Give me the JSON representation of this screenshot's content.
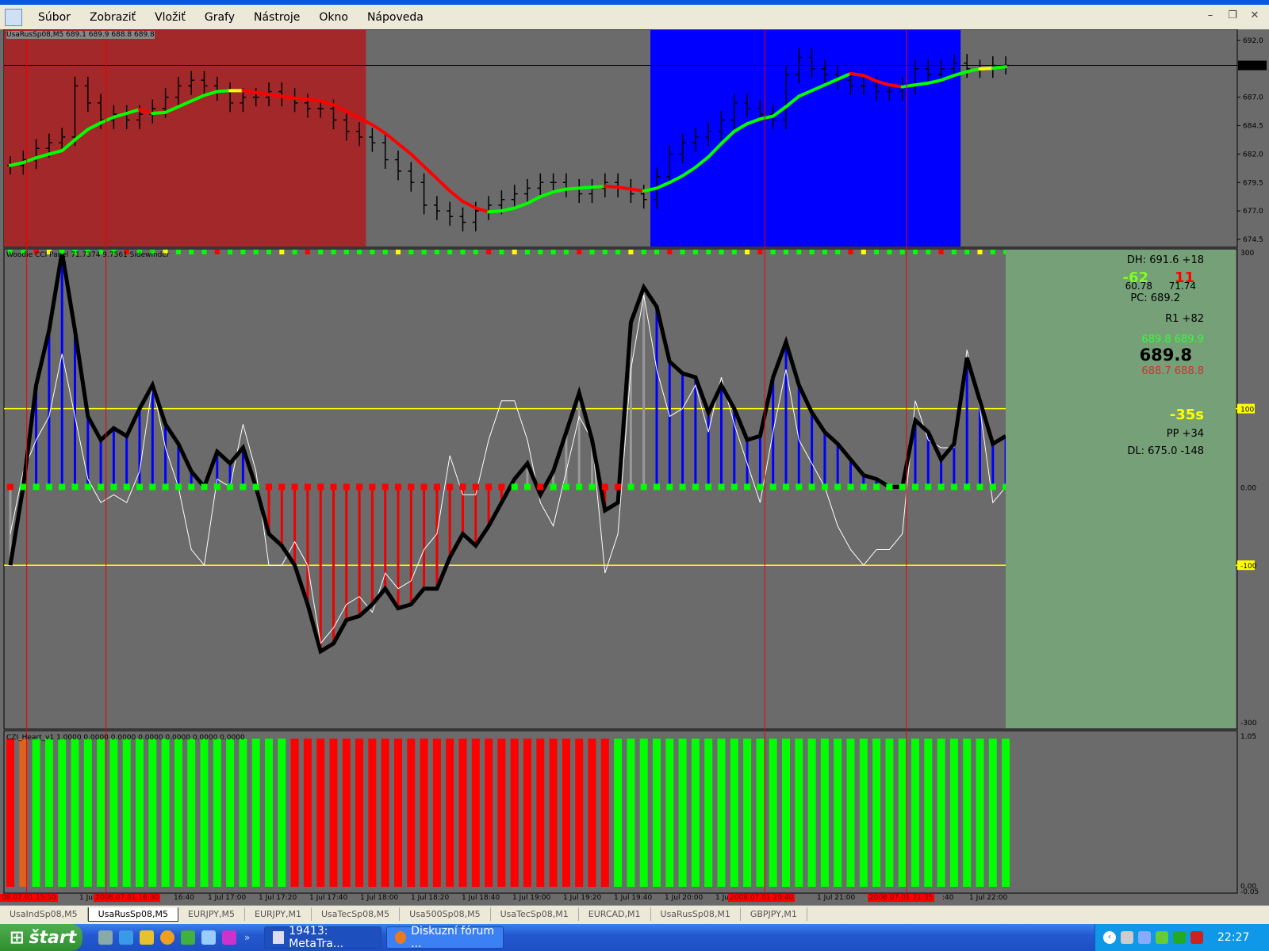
{
  "menu": {
    "items": [
      "Súbor",
      "Zobraziť",
      "Vložiť",
      "Grafy",
      "Nástroje",
      "Okno",
      "Nápoveda"
    ]
  },
  "window_controls": {
    "minimize": "–",
    "restore": "❐",
    "close": "✕"
  },
  "price_pane": {
    "label": "UsaRusSp08,M5  689.1 689.9 688.8 689.8",
    "axis_ticks": [
      "692.0",
      "687.0",
      "684.5",
      "682.0",
      "679.5",
      "677.0",
      "674.5"
    ],
    "current_price": "689.8"
  },
  "cci_pane": {
    "label": "Woodie CCI Panel 71.7374 9.7561  Sidewinder",
    "axis_ticks": {
      "top": "300",
      "upper": "100",
      "zero": "0.00",
      "lower": "-100",
      "bottom": "-300"
    }
  },
  "heart_pane": {
    "label": "CZI_Heart_v1 1.0000 0.0000 0.0000 0.0000 0.0000 0.0000 0.0000",
    "axis_ticks": {
      "top": "1.05",
      "bottom": "0.00",
      "bottom2": "-0.05"
    }
  },
  "info_panel": {
    "dh": "DH: 691.6 +18",
    "green_num": "-62",
    "red_num": "11",
    "val_left": "60.78",
    "val_right": "71.74",
    "pc": "PC: 689.2",
    "r1": "R1 +82",
    "ask_pair": "689.8  689.9",
    "price": "689.8",
    "bid_pair": "688.7  688.8",
    "timer": "-35s",
    "pp": "PP +34",
    "dl": "DL: 675.0 -148"
  },
  "time_axis": {
    "labels": [
      "1 Jul 16:00",
      "16:40",
      "1 Jul 17:00",
      "1 Jul 17:20",
      "1 Jul 17:40",
      "1 Jul 18:00",
      "1 Jul 18:20",
      "1 Jul 18:40",
      "1 Jul 19:00",
      "1 Jul 19:20",
      "1 Jul 19:40",
      "1 Jul 20:00",
      "1 Ju",
      "1 Jul 21:00",
      ":40",
      "1 Jul 22:00"
    ],
    "cursor_labels": [
      "08.07.01 15:50",
      "2008.07.01 16:30",
      "2008.07.01 20:40",
      "2008.07.01 21:35"
    ]
  },
  "tabs": [
    "UsaIndSp08,M5",
    "UsaRusSp08,M5",
    "EURJPY,M5",
    "EURJPY,M1",
    "UsaTecSp08,M5",
    "Usa500Sp08,M5",
    "UsaTecSp08,M1",
    "EURCAD,M1",
    "UsaRusSp08,M1",
    "GBPJPY,M1"
  ],
  "active_tab": "UsaRusSp08,M5",
  "taskbar": {
    "start": "štart",
    "tasks": [
      "19413: MetaTra...",
      "Diskuzní fórum ..."
    ],
    "clock": "22:27"
  },
  "colors": {
    "red_zone": "#a3282a",
    "blue_zone": "#0000ff",
    "bg": "#6b6b6b",
    "up": "#00ff00",
    "down": "#ff0000",
    "flat": "#ffff00",
    "panel": "#76a078"
  },
  "chart_data": [
    {
      "type": "line",
      "title": "UsaRusSp08,M5",
      "ylim": [
        674.5,
        692.0
      ],
      "close": [
        681,
        681.5,
        682.5,
        683,
        683.5,
        688,
        686.5,
        685,
        685.5,
        685,
        685.5,
        686,
        687,
        688,
        688.5,
        688,
        687.5,
        686.5,
        687,
        687,
        687.5,
        687,
        686.5,
        686,
        686,
        685,
        684,
        683.5,
        683,
        681.5,
        680.5,
        679.5,
        677.5,
        677,
        676.5,
        676,
        677,
        677.5,
        678,
        678.5,
        679,
        679.5,
        679.5,
        679,
        678.5,
        679,
        679.5,
        679,
        678.5,
        678,
        680,
        682,
        683,
        683.5,
        684,
        685,
        686.5,
        686,
        685.5,
        685,
        689,
        690.5,
        689.5,
        689,
        688.5,
        688,
        688,
        687.5,
        687.5,
        688,
        689.5,
        689,
        689.5,
        690,
        689.5,
        689.5,
        689.8,
        689.8
      ],
      "zones": [
        {
          "from": 0,
          "to": 27,
          "color": "#a3282a"
        },
        {
          "from": 50,
          "to": 73,
          "color": "#0000ff"
        }
      ]
    },
    {
      "type": "line",
      "title": "Woodie CCI",
      "ylim": [
        -300,
        300
      ],
      "cci": [
        -100,
        0,
        130,
        200,
        300,
        200,
        90,
        60,
        75,
        65,
        100,
        130,
        80,
        55,
        20,
        0,
        45,
        30,
        50,
        0,
        -60,
        -75,
        -100,
        -150,
        -210,
        -200,
        -170,
        -165,
        -150,
        -130,
        -155,
        -150,
        -130,
        -130,
        -90,
        -60,
        -75,
        -50,
        -20,
        10,
        30,
        -10,
        20,
        70,
        120,
        60,
        -30,
        -20,
        210,
        255,
        230,
        160,
        145,
        140,
        95,
        130,
        100,
        60,
        65,
        140,
        185,
        130,
        95,
        70,
        55,
        35,
        15,
        10,
        0,
        0,
        85,
        70,
        35,
        55,
        165,
        110,
        55,
        65
      ],
      "turbo": [
        -60,
        20,
        60,
        90,
        170,
        90,
        10,
        -20,
        -10,
        -20,
        20,
        130,
        50,
        0,
        -80,
        -100,
        10,
        0,
        80,
        20,
        -100,
        -100,
        -70,
        -100,
        -200,
        -180,
        -150,
        -140,
        -160,
        -110,
        -130,
        -120,
        -80,
        -60,
        40,
        -10,
        -10,
        60,
        110,
        110,
        60,
        -20,
        -50,
        20,
        90,
        60,
        -110,
        -60,
        150,
        245,
        150,
        90,
        100,
        130,
        70,
        140,
        80,
        30,
        -20,
        70,
        150,
        60,
        30,
        0,
        -50,
        -80,
        -100,
        -80,
        -80,
        -60,
        110,
        60,
        50,
        50,
        175,
        100,
        -20,
        0
      ]
    },
    {
      "type": "bar",
      "title": "CZI_Heart_v1",
      "ylim": [
        0,
        1.05
      ],
      "signal": [
        "r",
        "o",
        "g",
        "g",
        "g",
        "g",
        "g",
        "g",
        "g",
        "g",
        "g",
        "g",
        "g",
        "g",
        "g",
        "g",
        "g",
        "g",
        "g",
        "g",
        "g",
        "g",
        "r",
        "r",
        "r",
        "r",
        "r",
        "r",
        "r",
        "r",
        "r",
        "r",
        "r",
        "r",
        "r",
        "r",
        "r",
        "r",
        "r",
        "r",
        "r",
        "r",
        "r",
        "r",
        "r",
        "r",
        "r",
        "g",
        "g",
        "g",
        "g",
        "g",
        "g",
        "g",
        "g",
        "g",
        "g",
        "g",
        "g",
        "g",
        "g",
        "g",
        "g",
        "g",
        "g",
        "g",
        "g",
        "g",
        "g",
        "g",
        "g",
        "g",
        "g",
        "g",
        "g",
        "g",
        "g",
        "g"
      ]
    }
  ]
}
